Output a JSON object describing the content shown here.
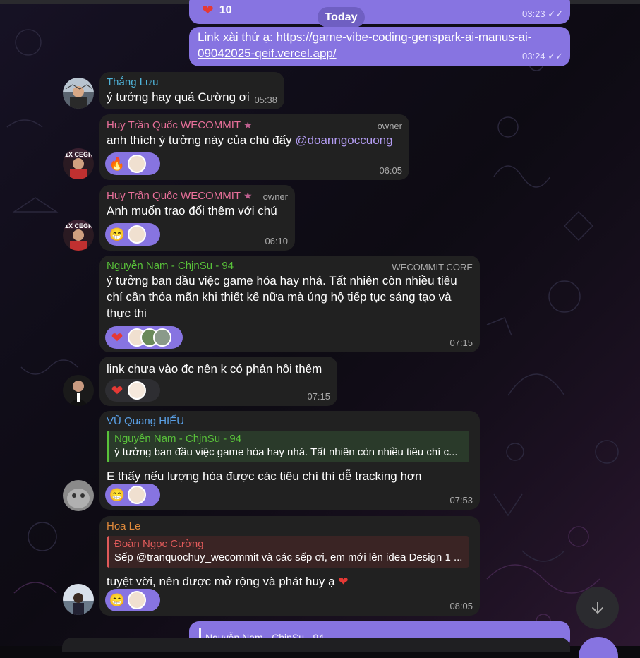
{
  "colors": {
    "accent": "#8774e1",
    "bubble_in": "#212121",
    "name_cyan": "#4fb3d9",
    "name_pink": "#e8709a",
    "name_green": "#59c23a",
    "name_blue": "#5aa0e6",
    "name_orange": "#e08a3c",
    "name_red": "#e05a5a"
  },
  "top_message": {
    "reaction_count": "10",
    "time": "03:23"
  },
  "date_divider": "Today",
  "link_message": {
    "prefix": "Link xài thử ạ: ",
    "url": "https://game-vibe-coding-genspark-ai-manus-ai-09042025-qeif.vercel.app/",
    "time": "03:24"
  },
  "messages": [
    {
      "sender": "Thắng Lưu",
      "text": "ý tưởng hay quá Cường ơi",
      "time": "05:38"
    },
    {
      "sender": "Huy Trần Quốc WECOMMIT",
      "role": "owner",
      "text": "anh thích ý tưởng này của chú đấy ",
      "mention": "@doanngoccuong",
      "time": "06:05"
    },
    {
      "sender": "Huy Trần Quốc WECOMMIT",
      "role": "owner",
      "text": "Anh muốn trao đổi thêm với chú",
      "time": "06:10"
    },
    {
      "sender": "Nguyễn Nam - ChjnSu - 94",
      "role": "WECOMMIT CORE",
      "text": "ý tưởng ban đầu việc game hóa hay nhá. Tất nhiên còn nhiều tiêu chí cần thỏa mãn khi thiết kế nữa mà ủng hộ tiếp tục sáng tạo và thực thi",
      "time": "07:15"
    },
    {
      "text": "link chưa vào đc nên k có phản hồi thêm",
      "time": "07:15"
    },
    {
      "sender": "VŨ Quang HIẾU",
      "reply_name": "Nguyễn Nam - ChjnSu - 94",
      "reply_text": "ý tưởng ban đầu việc game hóa hay nhá. Tất nhiên còn nhiều tiêu chí c...",
      "text": "E thấy nếu lượng hóa được các tiêu chí thì dễ tracking hơn",
      "time": "07:53"
    },
    {
      "sender": "Hoa Le",
      "reply_name": "Đoàn Ngọc Cường",
      "reply_text": "Sếp @tranquochuy_wecommit và các sếp ơi, em mới lên idea Design 1 ...",
      "text": "tuyệt vời, nên được mở rộng và phát huy ạ ",
      "time": "08:05"
    }
  ],
  "bottom_preview": "Nguyễn Nam - ChjnSu - 94",
  "icons": [
    "heart-icon",
    "fire-icon",
    "grin-icon",
    "star-icon",
    "double-check-icon",
    "arrow-down-icon"
  ]
}
